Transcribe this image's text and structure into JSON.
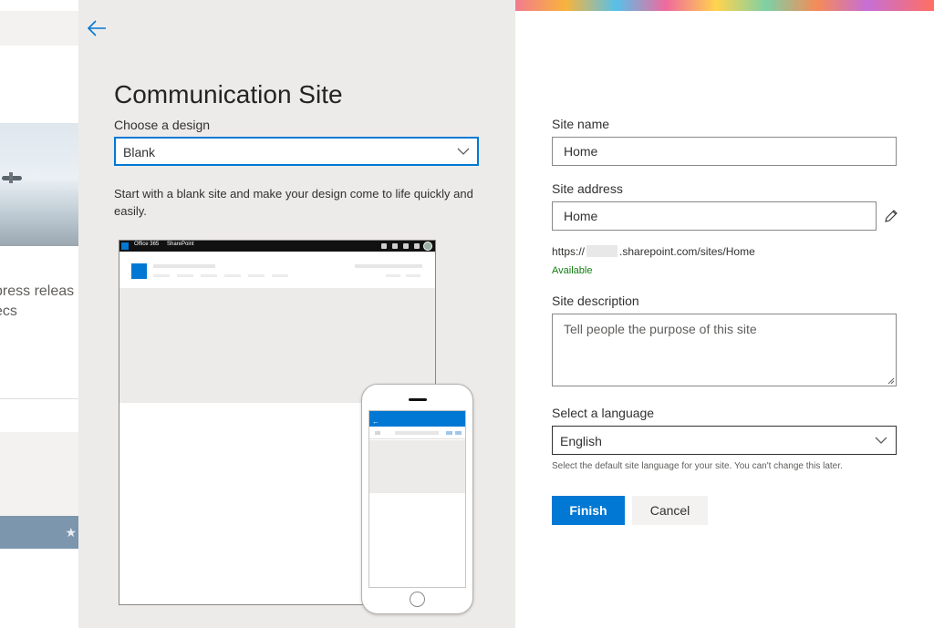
{
  "background_page": {
    "text_line1": "press releas",
    "text_line2": "ecs"
  },
  "panel": {
    "title": "Communication Site",
    "design_label": "Choose a design",
    "design_selected": "Blank",
    "design_description": "Start with a blank site and make your design come to life quickly and easily.",
    "preview": {
      "office_label": "Office 365",
      "sharepoint_label": "SharePoint"
    }
  },
  "form": {
    "site_name_label": "Site name",
    "site_name_value": "Home",
    "site_address_label": "Site address",
    "site_address_value": "Home",
    "url_prefix": "https://",
    "url_suffix": ".sharepoint.com/sites/Home",
    "availability": "Available",
    "description_label": "Site description",
    "description_placeholder": "Tell people the purpose of this site",
    "language_label": "Select a language",
    "language_selected": "English",
    "language_hint": "Select the default site language for your site. You can't change this later.",
    "finish_label": "Finish",
    "cancel_label": "Cancel"
  },
  "colors": {
    "accent": "#0078d4",
    "panel_bg": "#edebe9",
    "available": "#107c10"
  },
  "icons": {
    "back": "arrow-left-icon",
    "chevron": "chevron-down-icon",
    "edit": "pencil-icon"
  }
}
